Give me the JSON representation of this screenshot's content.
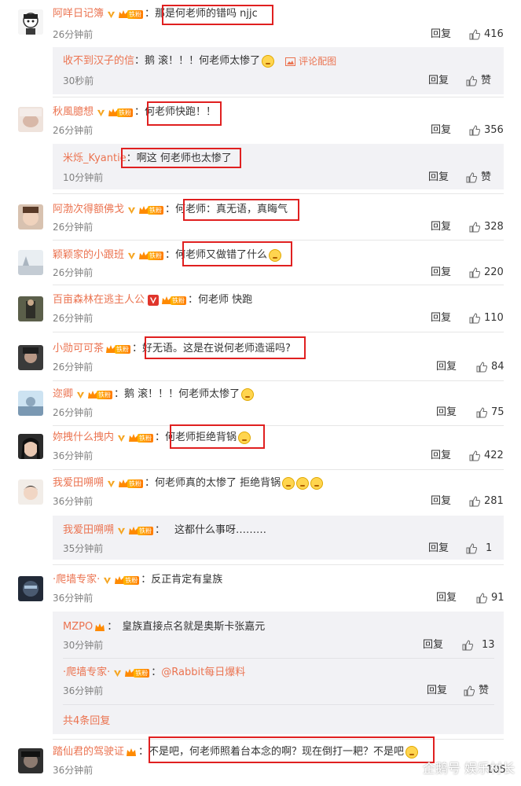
{
  "reply_label": "回复",
  "like_label": "赞",
  "comments": [
    {
      "user": "阿咩日记簿",
      "text": "那是何老师的错吗 njjc",
      "time": "26分钟前",
      "likes": "416"
    },
    {
      "user": "秋風臆想",
      "text": "何老师快跑！！",
      "time": "26分钟前",
      "likes": "356"
    },
    {
      "user": "阿渤次得额佛戈",
      "text": "何老师：真无语，真晦气",
      "time": "26分钟前",
      "likes": "328"
    },
    {
      "user": "颖颖家的小跟班",
      "text": "何老师又做错了什么",
      "time": "26分钟前",
      "likes": "220"
    },
    {
      "user": "百亩森林在逃主人公",
      "text": "何老师 快跑",
      "time": "26分钟前",
      "likes": "110"
    },
    {
      "user": "小勋可可茶",
      "text": "好无语。这是在说何老师造谣吗?",
      "time": "26分钟前",
      "likes": "84"
    },
    {
      "user": "迩卿",
      "text": "鹅  滚！！！何老师太惨了",
      "time": "26分钟前",
      "likes": "75"
    },
    {
      "user": "妳拽什么拽内",
      "text": "何老师拒绝背锅",
      "time": "36分钟前",
      "likes": "422"
    },
    {
      "user": "我爱田嗍嗍",
      "text": "何老师真的太惨了  拒绝背锅",
      "time": "36分钟前",
      "likes": "281"
    },
    {
      "user": "·爬墙专家·",
      "text": "反正肯定有皇族",
      "time": "36分钟前",
      "likes": "91"
    },
    {
      "user": "踏仙君的驾驶证",
      "text": "不是吧，何老师照着台本念的啊？现在倒打一耙？不是吧",
      "time": "36分钟前",
      "likes": "105"
    }
  ],
  "subs": [
    {
      "user": "收不到汉子的信",
      "text": "鹅  滚！！！何老师太惨了",
      "extra": "评论配图",
      "time": "30秒前",
      "likes": "赞"
    },
    {
      "user": "米烁_Kyantie",
      "text": "啊这 何老师也太惨了",
      "time": "10分钟前",
      "likes": "赞"
    },
    {
      "user": "我爱田嗍嗍",
      "text": "这都什么事呀………",
      "time": "35分钟前",
      "likes": "1"
    },
    {
      "user": "MZPO",
      "text": "皇族直接点名就是奥斯卡张嘉元",
      "time": "30分钟前",
      "likes": "13"
    },
    {
      "user": "·爬墙专家·",
      "text": "@Rabbit每日爆料",
      "time": "36分钟前",
      "likes": "赞"
    }
  ],
  "more_replies": "共4条回复",
  "fan_text": "铁粉",
  "watermark": "企鹅号 娱乐村长"
}
